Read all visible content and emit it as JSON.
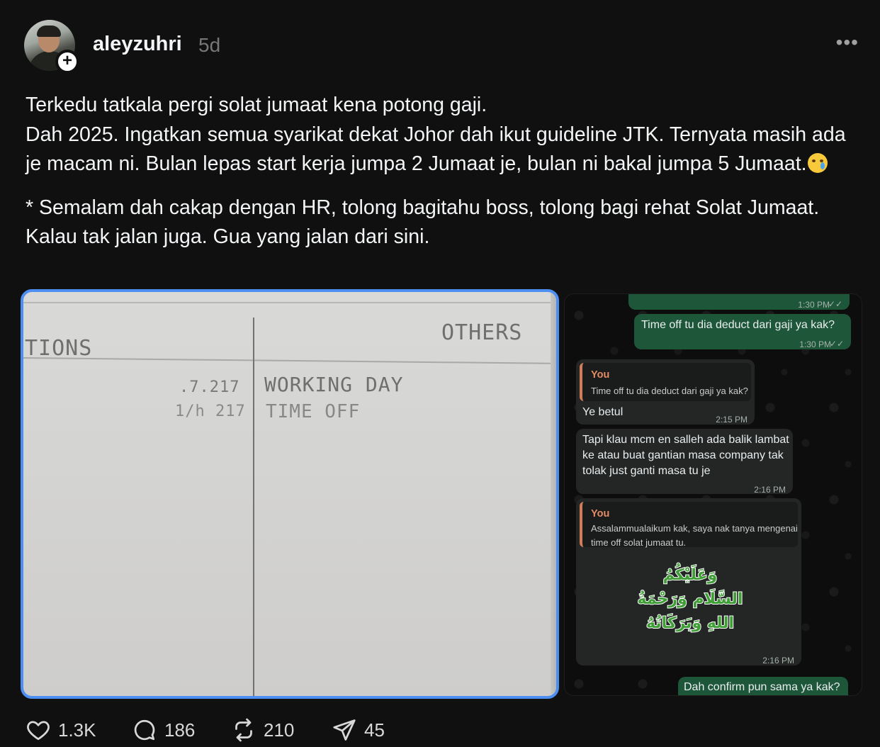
{
  "post": {
    "username": "aleyzuhri",
    "time": "5d",
    "more_label": "•••",
    "follow_symbol": "+",
    "text_line1": "Terkedu tatkala pergi solat jumaat kena potong gaji.",
    "text_line2": "Dah 2025. Ingatkan semua syarikat dekat Johor dah ikut guideline JTK. Ternyata masih ada je macam ni. Bulan lepas start kerja jumpa 2 Jumaat je, bulan ni bakal jumpa 5 Jumaat.",
    "text_line3": "* Semalam dah cakap dengan HR, tolong bagitahu boss, tolong bagi rehat Solat Jumaat. Kalau tak jalan juga. Gua yang jalan dari sini.",
    "emoji": "crying-face"
  },
  "photo": {
    "col_left": "TIONS",
    "col_right": "OTHERS",
    "code1": ".7.217",
    "code2": "1/h 217",
    "row1": "WORKING DAY",
    "row2": "TIME OFF"
  },
  "chat": {
    "msg0_time": "1:30 PM",
    "msg1_text": "Time off tu dia deduct dari gaji ya kak?",
    "msg1_time": "1:30 PM",
    "reply1_quote_name": "You",
    "reply1_quote_text": "Time off tu dia deduct dari gaji ya kak?",
    "reply1_text": "Ye betul",
    "reply1_time": "2:15 PM",
    "msg2_text": "Tapi klau mcm en salleh ada balik lambat ke atau buat gantian masa company tak tolak just ganti masa tu je",
    "msg2_time": "2:16 PM",
    "reply2_quote_name": "You",
    "reply2_quote_text": "Assalammualaikum kak, saya nak tanya mengenai time off solat jumaat tu.",
    "reply2_sticker": "وَعَلَيْكُمُ السَّلَام وَرَحْمَةُ اللهِ وَبَرَكَاتُهُ",
    "reply2_time": "2:16 PM",
    "msg3_text": "Dah confirm pun sama ya kak?"
  },
  "actions": {
    "likes": "1.3K",
    "comments": "186",
    "reposts": "210",
    "shares": "45"
  },
  "colors": {
    "background": "#101010",
    "outgoing_bubble": "#1d5639",
    "incoming_bubble": "#232624",
    "highlight_border": "#4d8ef2",
    "quote_accent": "#e58b65"
  }
}
